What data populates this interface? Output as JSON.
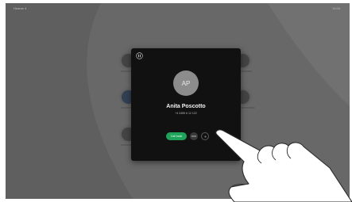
{
  "status_bar": {
    "left": "Hearse 4",
    "right": "11:04"
  },
  "contact": {
    "avatar_initials": "AP",
    "name": "Anita Poscotto",
    "subline": "+4 3455 6 12 122",
    "call_label": "Call back"
  },
  "colors": {
    "call_green": "#1fa35a",
    "card": "#111111",
    "screen": "#7f7f7f"
  },
  "icons": [
    "pause-icon",
    "more-icon",
    "record-icon",
    "hand-icon"
  ]
}
